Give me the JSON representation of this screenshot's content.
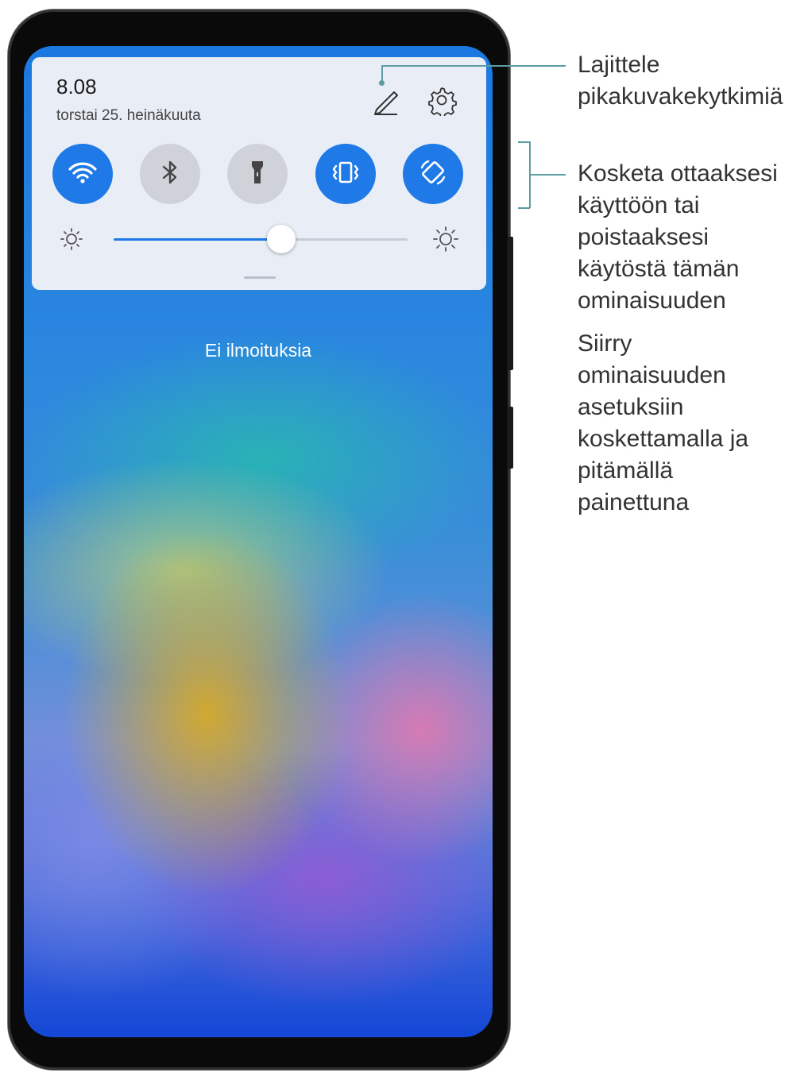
{
  "status": {
    "time": "8.08",
    "date": "torstai 25. heinäkuuta"
  },
  "quick_toggles": [
    {
      "name": "wifi",
      "icon": "wifi-icon",
      "state": "on"
    },
    {
      "name": "bluetooth",
      "icon": "bluetooth-icon",
      "state": "off"
    },
    {
      "name": "flashlight",
      "icon": "flashlight-icon",
      "state": "off"
    },
    {
      "name": "vibrate",
      "icon": "vibrate-icon",
      "state": "on"
    },
    {
      "name": "auto-rotate",
      "icon": "rotate-icon",
      "state": "on"
    }
  ],
  "brightness": {
    "level": 0.57
  },
  "notifications": {
    "empty_text": "Ei ilmoituksia"
  },
  "callouts": {
    "edit": [
      "Lajittele",
      "pikakuvakekytkimiä"
    ],
    "toggle": [
      "Kosketa ottaaksesi",
      "käyttöön tai",
      "poistaaksesi",
      "käytöstä tämän",
      "ominaisuuden"
    ],
    "long_press": [
      "Siirry",
      "ominaisuuden",
      "asetuksiin",
      "koskettamalla ja",
      "pitämällä",
      "painettuna"
    ]
  },
  "colors": {
    "accent": "#1f7ae8",
    "toggle_off": "#cfd3d9",
    "callout_line": "#5b9ca0"
  }
}
